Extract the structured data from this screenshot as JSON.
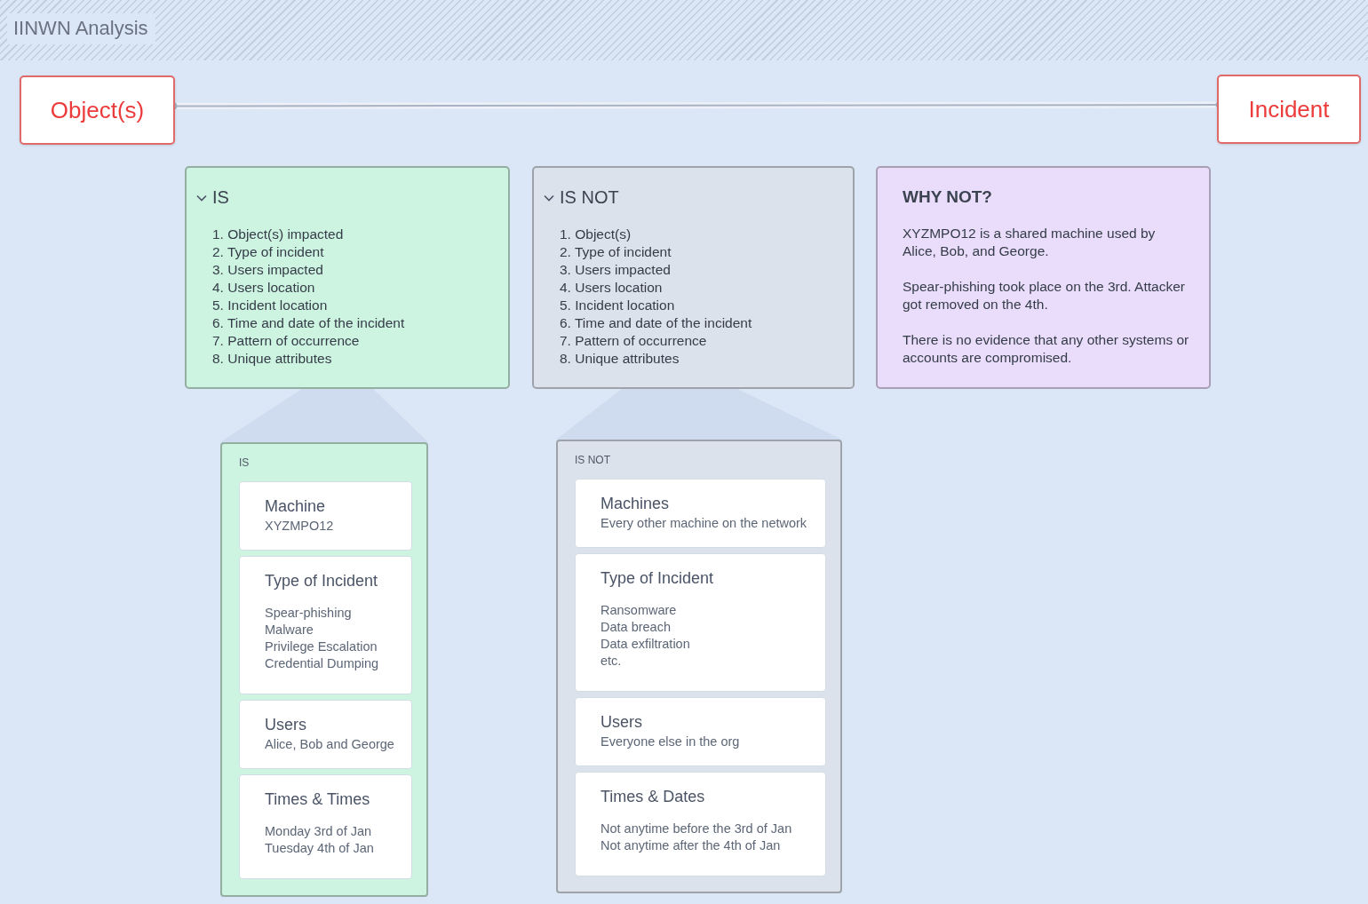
{
  "board": {
    "title": "IINWN Analysis"
  },
  "endpoints": [
    {
      "label": "Object(s)"
    },
    {
      "label": "Incident"
    }
  ],
  "cards": [
    {
      "title": "IS",
      "expanded": true,
      "color": "#cdf3e1",
      "kind": "list",
      "items": [
        "1. Object(s) impacted",
        "2. Type of incident",
        "3. Users impacted",
        "4. Users location",
        "5. Incident location",
        "6. Time and date of the incident",
        "7. Pattern of occurrence",
        "8. Unique attributes"
      ]
    },
    {
      "title": "IS NOT",
      "expanded": true,
      "color": "#dce2ec",
      "kind": "list",
      "items": [
        "1. Object(s)",
        "2. Type of incident",
        "3. Users impacted",
        "4. Users location",
        "5. Incident location",
        "6. Time and date of the incident",
        "7. Pattern of occurrence",
        "8. Unique attributes"
      ]
    },
    {
      "title": "WHY NOT?",
      "color": "#e9ddfb",
      "kind": "text",
      "paragraphs": [
        "XYZMPO12 is a shared machine used by Alice, Bob, and George.",
        "Spear-phishing took place on the 3rd. Attacker got removed on the 4th.",
        "There is no evidence that any other systems or accounts are compromised."
      ]
    }
  ],
  "panels": [
    {
      "title": "IS",
      "color": "#cdf3e1",
      "items": [
        {
          "title": "Machine",
          "lines": [
            "XYZMPO12"
          ]
        },
        {
          "title": "Type of Incident",
          "lines": [
            "Spear-phishing",
            "Malware",
            "Privilege Escalation",
            "Credential Dumping"
          ]
        },
        {
          "title": "Users",
          "lines": [
            "Alice, Bob and George"
          ]
        },
        {
          "title": "Times & Times",
          "lines": [
            "Monday 3rd of Jan",
            "Tuesday 4th of Jan"
          ]
        }
      ]
    },
    {
      "title": "IS NOT",
      "color": "#dce2ec",
      "items": [
        {
          "title": "Machines",
          "lines": [
            "Every other machine on the network"
          ]
        },
        {
          "title": "Type of Incident",
          "lines": [
            "Ransomware",
            "Data breach",
            "Data exfiltration",
            "etc."
          ]
        },
        {
          "title": "Users",
          "lines": [
            "Everyone else in the org"
          ]
        },
        {
          "title": "Times & Dates",
          "lines": [
            "Not anytime before the 3rd of Jan",
            "Not anytime after the 4th of Jan"
          ]
        }
      ]
    }
  ]
}
